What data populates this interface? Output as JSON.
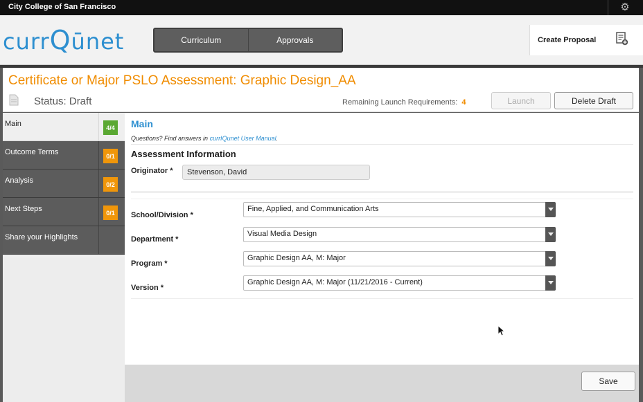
{
  "topbar": {
    "college": "City College of San Francisco"
  },
  "header": {
    "logo": {
      "part1": "curr",
      "part2": "Q",
      "part3": "ūnet"
    },
    "tabs": [
      {
        "label": "Curriculum"
      },
      {
        "label": "Approvals"
      }
    ],
    "create_proposal": "Create Proposal"
  },
  "page": {
    "title": "Certificate or Major PSLO Assessment: Graphic Design_AA",
    "status": "Status: Draft",
    "remaining_label": "Remaining Launch Requirements:",
    "remaining_count": "4",
    "launch_button": "Launch",
    "delete_button": "Delete Draft"
  },
  "sidebar": {
    "items": [
      {
        "label": "Main",
        "badge": "4/4",
        "badge_color": "#5aa832"
      },
      {
        "label": "Outcome Terms",
        "badge": "0/1",
        "badge_color": "#f0960a"
      },
      {
        "label": "Analysis",
        "badge": "0/2",
        "badge_color": "#f0960a"
      },
      {
        "label": "Next Steps",
        "badge": "0/1",
        "badge_color": "#f0960a"
      },
      {
        "label": "Share your Highlights",
        "badge": ""
      }
    ]
  },
  "main": {
    "heading": "Main",
    "help_prefix": "Questions? Find answers in ",
    "help_link": "currIQunet User Manual",
    "help_suffix": ".",
    "section_title": "Assessment Information",
    "originator_label": "Originator *",
    "originator_value": "Stevenson, David",
    "fields": [
      {
        "label": "School/Division *",
        "value": "Fine, Applied, and Communication Arts"
      },
      {
        "label": "Department *",
        "value": "Visual Media Design"
      },
      {
        "label": "Program *",
        "value": "Graphic Design AA, M: Major"
      },
      {
        "label": "Version *",
        "value": "Graphic Design AA, M: Major (11/21/2016 -  Current)"
      }
    ]
  },
  "footer": {
    "save_button": "Save"
  },
  "colors": {
    "accent_orange": "#f08c00",
    "accent_blue": "#2d8fd0"
  }
}
